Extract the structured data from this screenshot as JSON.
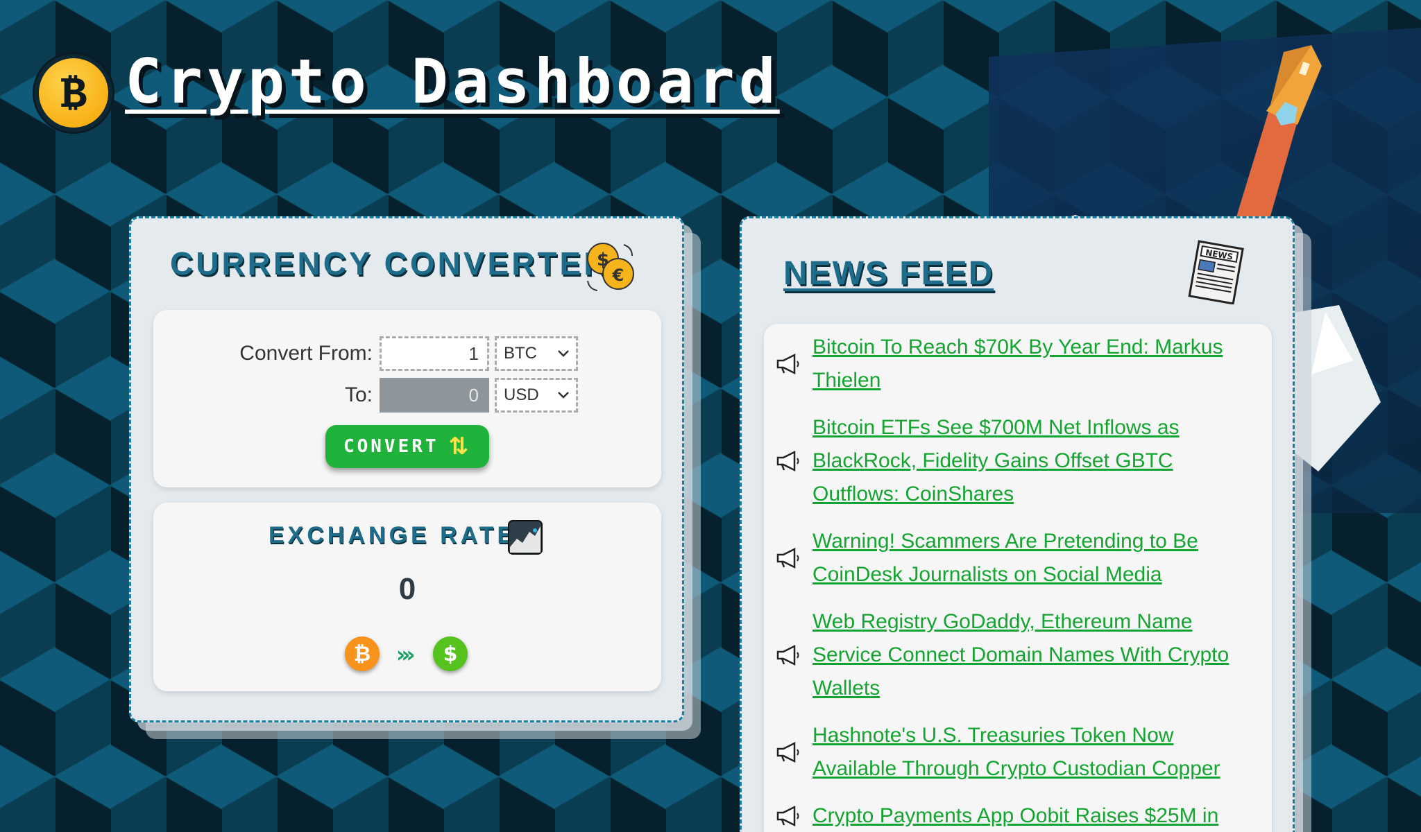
{
  "header": {
    "logo_glyph": "₿",
    "title": "Crypto Dashboard"
  },
  "converter": {
    "title": "CURRENCY CONVERTER",
    "from_label": "Convert From:",
    "from_amount": "1",
    "from_currency": "BTC",
    "to_label": "To:",
    "to_amount": "0",
    "to_currency": "USD",
    "convert_label": "CONVERT",
    "exchange": {
      "title": "EXCHANGE RATE",
      "value": "0",
      "from_coin_glyph": "₿",
      "to_coin_glyph": "$",
      "arrow_glyph": "›››"
    }
  },
  "news": {
    "title": "NEWS FEED",
    "items": [
      {
        "headline": "Bitcoin To Reach $70K By Year End: Markus Thielen"
      },
      {
        "headline": "Bitcoin ETFs See $700M Net Inflows as BlackRock, Fidelity Gains Offset GBTC Outflows: CoinShares"
      },
      {
        "headline": "Warning! Scammers Are Pretending to Be CoinDesk Journalists on Social Media"
      },
      {
        "headline": "Web Registry GoDaddy, Ethereum Name Service Connect Domain Names With Crypto Wallets"
      },
      {
        "headline": "Hashnote's U.S. Treasuries Token Now Available Through Crypto Custodian Copper"
      },
      {
        "headline": "Crypto Payments App Oobit Raises $25M in"
      }
    ]
  },
  "colors": {
    "accent": "#1d6d8a",
    "button": "#1fb33c",
    "link": "#15a431",
    "btc": "#f7931a",
    "usd": "#55c21e"
  }
}
